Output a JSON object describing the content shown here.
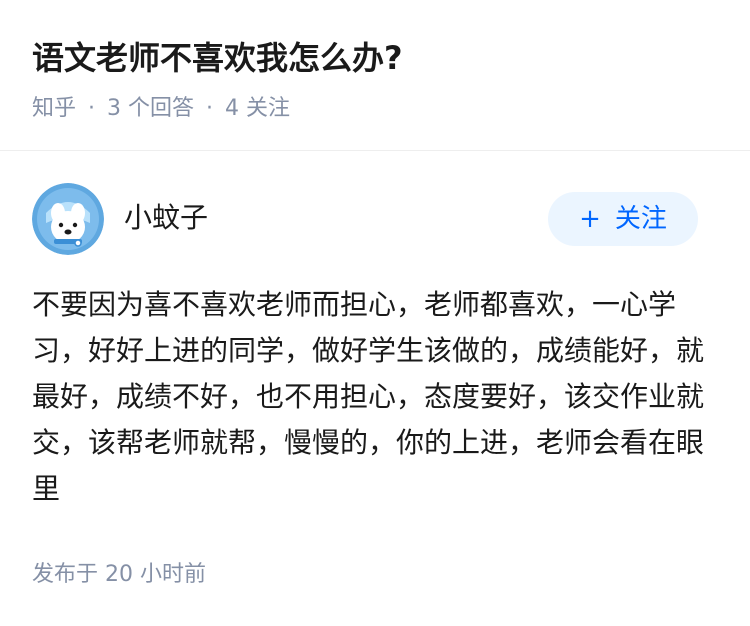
{
  "question": {
    "title": "语文老师不喜欢我怎么办?",
    "source": "知乎",
    "separator": "·",
    "answer_count": "3 个回答",
    "follower_count": "4 关注"
  },
  "author": {
    "name": "小蚊子",
    "avatar_icon": "cartoon-dog-avatar-icon",
    "follow_plus": "+",
    "follow_label": "关注"
  },
  "answer": {
    "content": "不要因为喜不喜欢老师而担心，老师都喜欢，一心学习，好好上进的同学，做好学生该做的，成绩能好，就最好，成绩不好，也不用担心，态度要好，该交作业就交，该帮老师就帮，慢慢的，你的上进，老师会看在眼里",
    "publish_label": "发布于",
    "publish_time": "20 小时前"
  },
  "colors": {
    "meta_gray": "#8590a6",
    "accent_blue": "#0066ff",
    "follow_bg": "#ebf5ff",
    "avatar_bg": "#5fa8e0"
  }
}
